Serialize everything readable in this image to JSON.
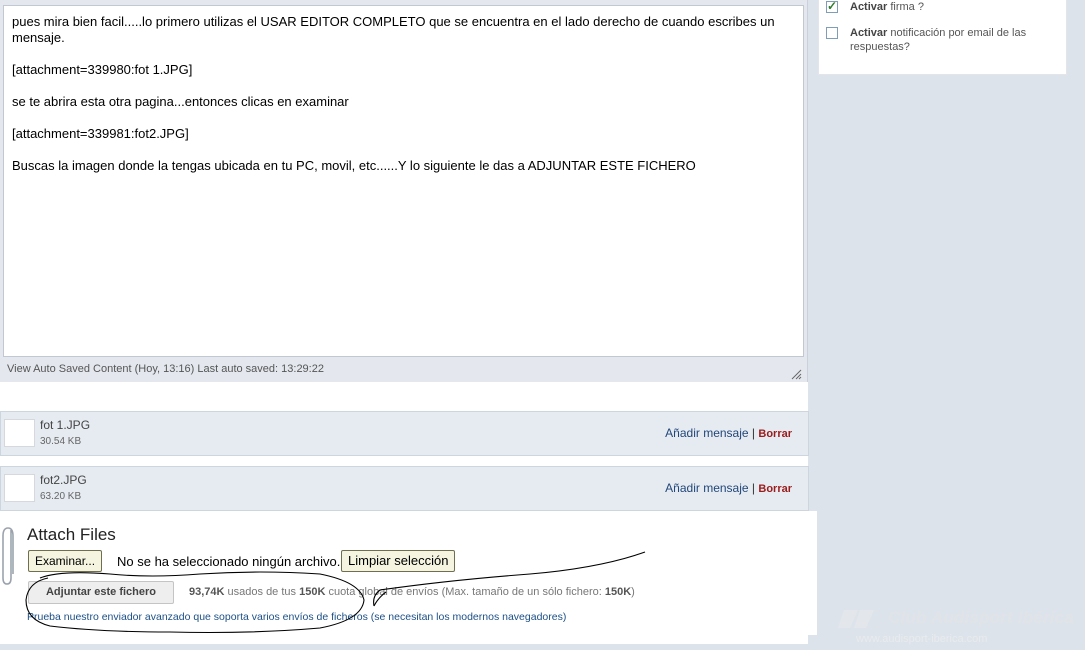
{
  "options": {
    "signature_bold": "Activar",
    "signature_rest": " firma ?",
    "signature_checked": true,
    "notify_bold": "Activar",
    "notify_rest": " notificación por email de las respuestas?",
    "notify_checked": false
  },
  "editor": {
    "paragraphs": [
      "pues mira bien facil.....lo primero utilizas el USAR EDITOR COMPLETO que se encuentra en el lado derecho de cuando escribes un mensaje.",
      "[attachment=339980:fot 1.JPG]",
      "se te abrira esta otra pagina...entonces clicas en examinar",
      "[attachment=339981:fot2.JPG]",
      "Buscas la imagen donde la tengas ubicada en tu PC, movil, etc......Y lo siguiente le das a ADJUNTAR ESTE FICHERO"
    ],
    "autosave_text": "View Auto Saved Content (Hoy, 13:16)  Last auto saved: 13:29:22"
  },
  "attachments": [
    {
      "name": "fot 1.JPG",
      "size": "30.54 KB",
      "add_label": "Añadir mensaje",
      "separator": "|",
      "delete_label": "Borrar"
    },
    {
      "name": "fot2.JPG",
      "size": "63.20 KB",
      "add_label": "Añadir mensaje",
      "separator": "|",
      "delete_label": "Borrar"
    }
  ],
  "attach": {
    "title": "Attach Files",
    "browse_label": "Examinar...",
    "no_file_text": "No se ha seleccionado ningún archivo.",
    "clear_label": "Limpiar selección",
    "upload_label": "Adjuntar este fichero",
    "quota_used": "93,74K",
    "quota_mid": " usados de tus ",
    "quota_total": "150K",
    "quota_rest": " cuota global de envíos (Max. tamaño de un sólo fichero: ",
    "quota_max": "150K",
    "quota_end": ")",
    "advanced_link": "Prueba nuestro enviador avanzado que soporta varios envíos de ficheros (se necesitan los modernos navegadores)"
  },
  "watermark": {
    "brand": "Club Audisport Ibérica",
    "url": "www.audisport-iberica.com"
  }
}
